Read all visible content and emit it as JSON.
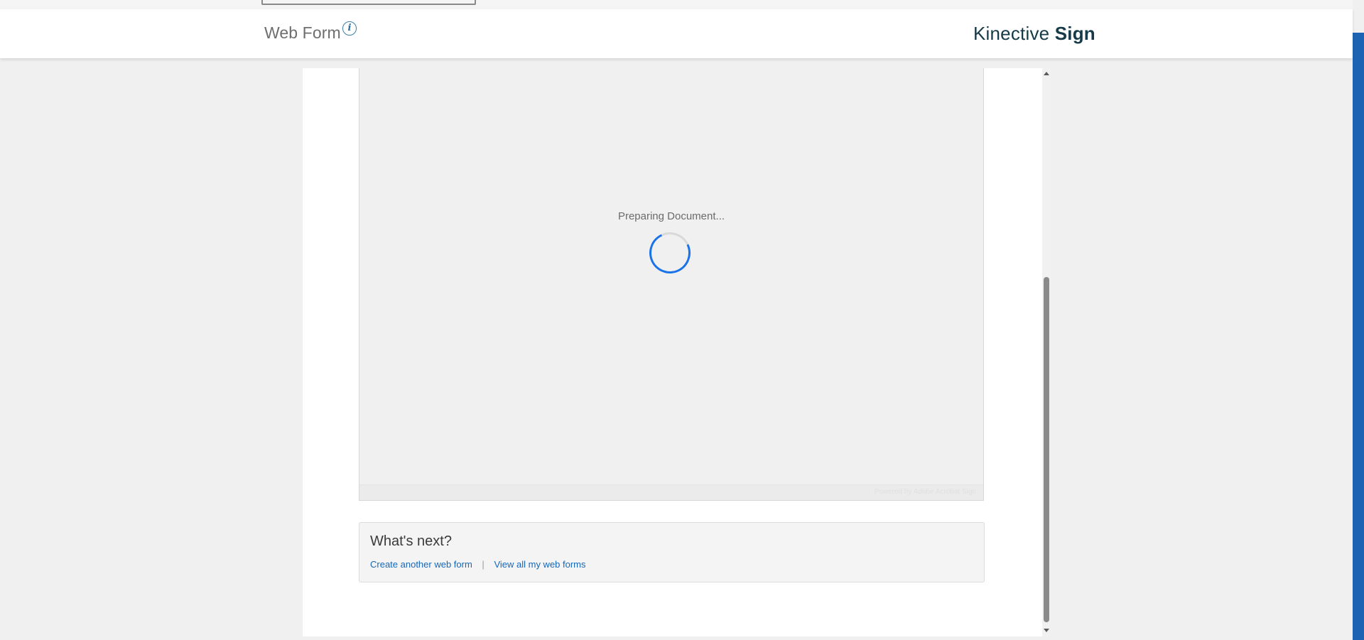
{
  "header": {
    "title": "Web Form",
    "info_icon": "i",
    "brand_light": "Kinective",
    "brand_bold": "Sign"
  },
  "viewer": {
    "status": "Preparing Document...",
    "powered_by": "Powered by Adobe Acrobat Sign"
  },
  "next": {
    "title": "What's next?",
    "create_link": "Create another web form",
    "separator": "|",
    "view_link": "View all my web forms"
  },
  "colors": {
    "accent": "#1d63b3",
    "link": "#1667b8",
    "spinner": "#1a73e8",
    "brand": "#163a47"
  }
}
